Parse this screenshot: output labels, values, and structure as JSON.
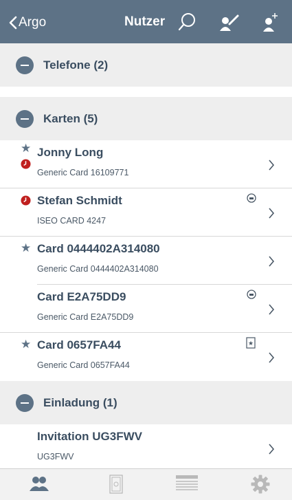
{
  "navbar": {
    "back_label": "Argo",
    "title": "Nutzer"
  },
  "sections": {
    "telefone": {
      "title": "Telefone (2)"
    },
    "karten": {
      "title": "Karten (5)"
    },
    "einladung": {
      "title": "Einladung (1)"
    }
  },
  "cards": [
    {
      "title": "Jonny Long",
      "subtitle": "Generic Card 16109771",
      "starred": true,
      "clock": true
    },
    {
      "title": "Stefan Schmidt",
      "subtitle": "ISEO CARD 4247",
      "starred": false,
      "clock": true,
      "badge": "sync-icon"
    },
    {
      "title": "Card 0444402A314080",
      "subtitle": "Generic Card 0444402A314080",
      "starred": true
    },
    {
      "title": "Card E2A75DD9",
      "subtitle": "Generic Card E2A75DD9",
      "starred": false,
      "badge": "sync-icon"
    },
    {
      "title": "Card 0657FA44",
      "subtitle": "Generic Card 0657FA44",
      "starred": true,
      "badge": "card-star-icon"
    }
  ],
  "invitations": [
    {
      "title": "Invitation UG3FWV",
      "subtitle": "UG3FWV"
    }
  ],
  "tabbar": {
    "tabs": [
      "users-icon",
      "door-icon",
      "list-icon",
      "settings-icon"
    ],
    "active": 0
  },
  "colors": {
    "accent": "#5d7286",
    "section_bg": "#eeeeee",
    "clock_red": "#c0201f"
  }
}
